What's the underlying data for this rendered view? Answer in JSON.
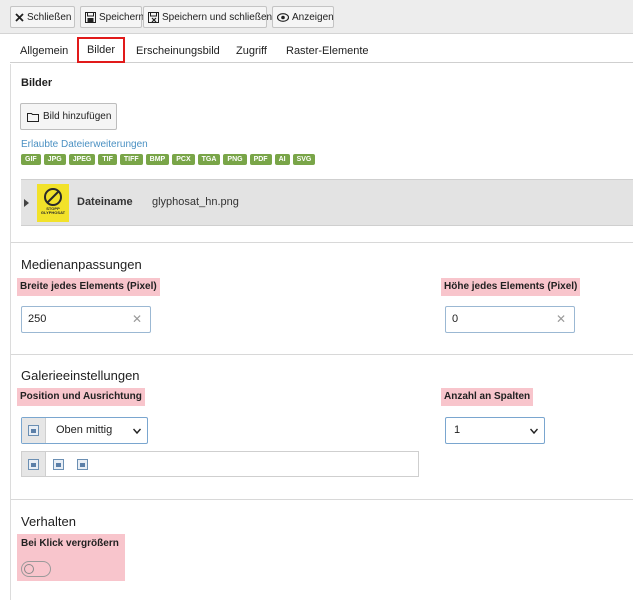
{
  "toolbar": {
    "close_label": "Schließen",
    "save_label": "Speichern",
    "save_close_label": "Speichern und schließen",
    "view_label": "Anzeigen"
  },
  "tabs": [
    {
      "label": "Allgemein"
    },
    {
      "label": "Bilder"
    },
    {
      "label": "Erscheinungsbild"
    },
    {
      "label": "Zugriff"
    },
    {
      "label": "Raster-Elemente"
    }
  ],
  "images": {
    "title": "Bilder",
    "add_button": "Bild hinzufügen",
    "allowed_link": "Erlaubte Dateierweiterungen",
    "extensions": [
      "GIF",
      "JPG",
      "JPEG",
      "TIF",
      "TIFF",
      "BMP",
      "PCX",
      "TGA",
      "PNG",
      "PDF",
      "AI",
      "SVG"
    ],
    "file": {
      "name_label": "Dateiname",
      "name_value": "glyphosat_hn.png",
      "thumb_text": "STOPP GLYPHOSAT"
    }
  },
  "media": {
    "title": "Medienanpassungen",
    "width_label": "Breite jedes Elements (Pixel)",
    "width_value": "250",
    "height_label": "Höhe jedes Elements (Pixel)",
    "height_value": "0"
  },
  "gallery": {
    "title": "Galerieeinstellungen",
    "position_label": "Position und Ausrichtung",
    "position_value": "Oben mittig",
    "columns_label": "Anzahl an Spalten",
    "columns_value": "1"
  },
  "behavior": {
    "title": "Verhalten",
    "click_enlarge_label": "Bei Klick vergrößern",
    "click_enlarge_on": false
  },
  "colors": {
    "highlight": "#f8c5cc",
    "active_tab_border": "#e11a1a",
    "extension_badge": "#79a548",
    "link": "#4a90c2"
  }
}
